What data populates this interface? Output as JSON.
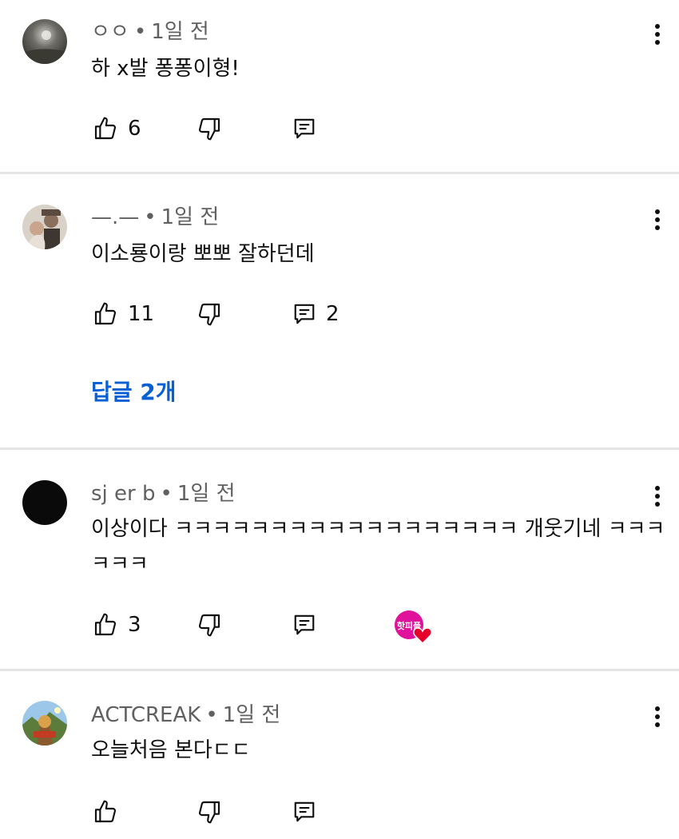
{
  "comments": [
    {
      "author": "ㅇㅇ",
      "time": "1일 전",
      "text": "하 x발 퐁퐁이형!",
      "likes": "6",
      "replies": ""
    },
    {
      "author": "—.—",
      "time": "1일 전",
      "text": "이소룡이랑 뽀뽀 잘하던데",
      "likes": "11",
      "replies": "2",
      "replies_link": "답글 2개"
    },
    {
      "author": "sj er b",
      "time": "1일 전",
      "text": "이상이다 ㅋㅋㅋㅋㅋㅋㅋㅋㅋㅋㅋㅋㅋㅋㅋㅋㅋㅋ 개웃기네 ㅋㅋㅋㅋㅋㅋ",
      "likes": "3",
      "replies": "",
      "creator_heart_text": "핫피플"
    },
    {
      "author": "ACTCREAK",
      "time": "1일 전",
      "text": "오늘처음 본다ㄷㄷ",
      "likes": "",
      "replies": ""
    }
  ],
  "separator": "•",
  "colors": {
    "link": "#065fd4",
    "meta": "#606060",
    "divider": "#e5e5e5",
    "heart": "#e4002b"
  },
  "icons": {
    "like": "thumb-up-icon",
    "dislike": "thumb-down-icon",
    "reply": "reply-comment-icon",
    "more": "more-vertical-icon"
  }
}
